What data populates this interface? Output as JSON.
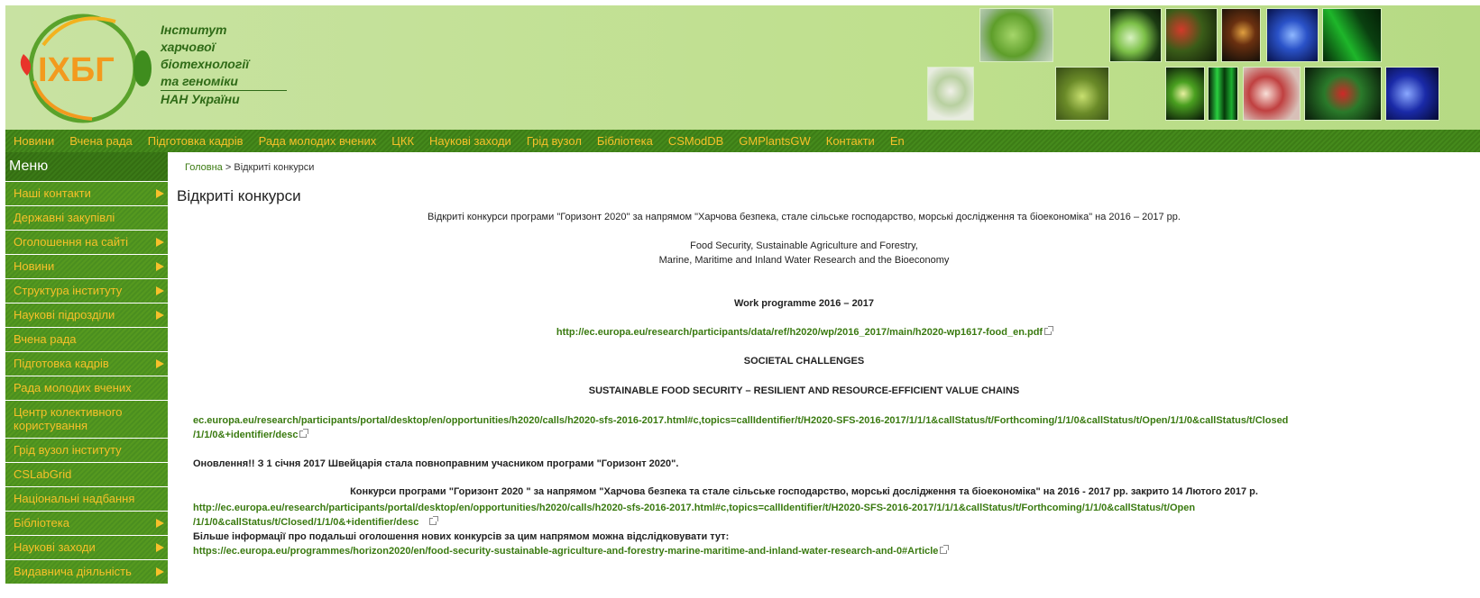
{
  "header": {
    "logo_abbr": "ІХБГ",
    "org_lines": [
      "Інститут",
      "харчової",
      "біотехнології",
      "та геноміки",
      "НАН України"
    ],
    "colors": {
      "brand_green": "#2f6b17",
      "accent_orange": "#f39a1e",
      "header_bg": "#c3e196"
    }
  },
  "topnav": {
    "items": [
      "Новини",
      "Вчена рада",
      "Підготовка кадрів",
      "Рада молодих вчених",
      "ЦКК",
      "Наукові заходи",
      "Грід вузол",
      "Бібліотека",
      "CSModDB",
      "GMPlantsGW",
      "Контакти",
      "En"
    ]
  },
  "sidebar": {
    "title": "Меню",
    "items": [
      {
        "label": "Наші контакти",
        "has_submenu": true
      },
      {
        "label": "Державні закупівлі",
        "has_submenu": false
      },
      {
        "label": "Оголошення на сайті",
        "has_submenu": true
      },
      {
        "label": "Новини",
        "has_submenu": true
      },
      {
        "label": "Структура інституту",
        "has_submenu": true
      },
      {
        "label": "Наукові підрозділи",
        "has_submenu": true
      },
      {
        "label": "Вчена рада",
        "has_submenu": false
      },
      {
        "label": "Підготовка кадрів",
        "has_submenu": true
      },
      {
        "label": "Рада молодих вчених",
        "has_submenu": false
      },
      {
        "label": "Центр колективного користування",
        "has_submenu": false
      },
      {
        "label": "Грід вузол інституту",
        "has_submenu": false
      },
      {
        "label": "CSLabGrid",
        "has_submenu": false
      },
      {
        "label": "Національні надбання",
        "has_submenu": false
      },
      {
        "label": "Бібліотека",
        "has_submenu": true
      },
      {
        "label": "Наукові заходи",
        "has_submenu": true
      },
      {
        "label": "Видавнича діяльність",
        "has_submenu": true
      }
    ]
  },
  "main": {
    "breadcrumb": {
      "home": "Головна",
      "separator": ">",
      "current": "Відкриті конкурси"
    },
    "title": "Відкриті конкурси",
    "intro": "Відкриті конкурси програми \"Горизонт 2020\" за напрямом \"Харчова безпека, стале сільське господарство, морські дослідження та біоекономіка\" на 2016 – 2017 рр.",
    "topic_line1": "Food Security, Sustainable Agriculture and Forestry,",
    "topic_line2": "Marine, Maritime and Inland Water Research and the Bioeconomy",
    "work_programme": "Work programme 2016  – 2017",
    "wp_link": "http://ec.europa.eu/research/participants/data/ref/h2020/wp/2016_2017/main/h2020-wp1617-food_en.pdf",
    "societal": "SOCIETAL CHALLENGES",
    "sustainable": "SUSTAINABLE FOOD SECURITY – RESILIENT AND RESOURCE-EFFICIENT VALUE CHAINS",
    "calls_link_line1": "ec.europa.eu/research/participants/portal/desktop/en/opportunities/h2020/calls/h2020-sfs-2016-2017.html#c,topics=callIdentifier/t/H2020-SFS-2016-2017/1/1/1&callStatus/t/Forthcoming/1/1/0&callStatus/t/Open/1/1/0&callStatus/t/Closed",
    "calls_link_line2": "/1/1/0&+identifier/desc",
    "update_note": "Оновлення!! З 1 січня 2017 Швейцарія стала повноправним учасником програми \"Горизонт 2020\".",
    "closed_note": "Конкурси програми \"Горизонт 2020 \" за напрямом \"Харчова безпека та стале сільське господарство, морські дослідження та біоекономіка\" на 2016 - 2017 рр. закрито 14 Лютого 2017 р.",
    "closed_link_line1": "http://ec.europa.eu/research/participants/portal/desktop/en/opportunities/h2020/calls/h2020-sfs-2016-2017.html#c,topics=callIdentifier/t/H2020-SFS-2016-2017/1/1/1&callStatus/t/Forthcoming/1/1/0&callStatus/t/Open",
    "closed_link_line2": "/1/1/0&callStatus/t/Closed/1/1/0&+identifier/desc",
    "more_info": "Більше інформації про подальші оголошення нових конкурсів за цим напрямом можна відслідковувати тут:",
    "more_link": "https://ec.europa.eu/programmes/horizon2020/en/food-security-sustainable-agriculture-and-forestry-marine-maritime-and-inland-water-research-and-0#Article"
  }
}
